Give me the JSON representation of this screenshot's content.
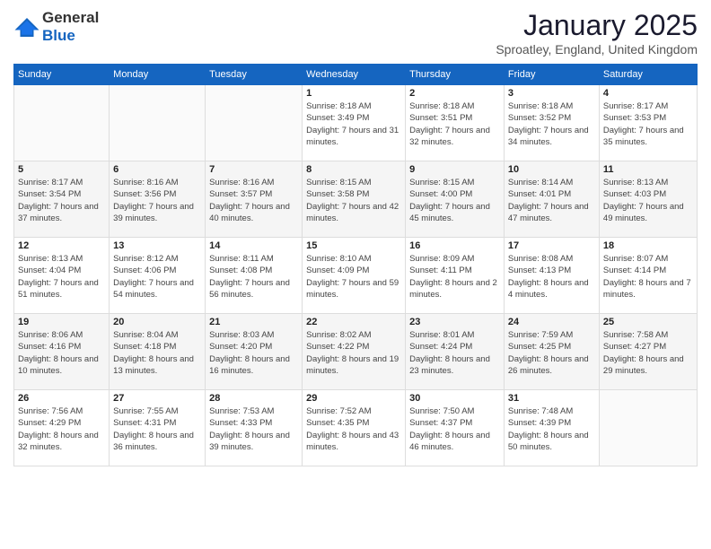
{
  "header": {
    "logo_general": "General",
    "logo_blue": "Blue",
    "title": "January 2025",
    "location": "Sproatley, England, United Kingdom"
  },
  "days_of_week": [
    "Sunday",
    "Monday",
    "Tuesday",
    "Wednesday",
    "Thursday",
    "Friday",
    "Saturday"
  ],
  "weeks": [
    [
      {
        "day": "",
        "sunrise": "",
        "sunset": "",
        "daylight": ""
      },
      {
        "day": "",
        "sunrise": "",
        "sunset": "",
        "daylight": ""
      },
      {
        "day": "",
        "sunrise": "",
        "sunset": "",
        "daylight": ""
      },
      {
        "day": "1",
        "sunrise": "Sunrise: 8:18 AM",
        "sunset": "Sunset: 3:49 PM",
        "daylight": "Daylight: 7 hours and 31 minutes."
      },
      {
        "day": "2",
        "sunrise": "Sunrise: 8:18 AM",
        "sunset": "Sunset: 3:51 PM",
        "daylight": "Daylight: 7 hours and 32 minutes."
      },
      {
        "day": "3",
        "sunrise": "Sunrise: 8:18 AM",
        "sunset": "Sunset: 3:52 PM",
        "daylight": "Daylight: 7 hours and 34 minutes."
      },
      {
        "day": "4",
        "sunrise": "Sunrise: 8:17 AM",
        "sunset": "Sunset: 3:53 PM",
        "daylight": "Daylight: 7 hours and 35 minutes."
      }
    ],
    [
      {
        "day": "5",
        "sunrise": "Sunrise: 8:17 AM",
        "sunset": "Sunset: 3:54 PM",
        "daylight": "Daylight: 7 hours and 37 minutes."
      },
      {
        "day": "6",
        "sunrise": "Sunrise: 8:16 AM",
        "sunset": "Sunset: 3:56 PM",
        "daylight": "Daylight: 7 hours and 39 minutes."
      },
      {
        "day": "7",
        "sunrise": "Sunrise: 8:16 AM",
        "sunset": "Sunset: 3:57 PM",
        "daylight": "Daylight: 7 hours and 40 minutes."
      },
      {
        "day": "8",
        "sunrise": "Sunrise: 8:15 AM",
        "sunset": "Sunset: 3:58 PM",
        "daylight": "Daylight: 7 hours and 42 minutes."
      },
      {
        "day": "9",
        "sunrise": "Sunrise: 8:15 AM",
        "sunset": "Sunset: 4:00 PM",
        "daylight": "Daylight: 7 hours and 45 minutes."
      },
      {
        "day": "10",
        "sunrise": "Sunrise: 8:14 AM",
        "sunset": "Sunset: 4:01 PM",
        "daylight": "Daylight: 7 hours and 47 minutes."
      },
      {
        "day": "11",
        "sunrise": "Sunrise: 8:13 AM",
        "sunset": "Sunset: 4:03 PM",
        "daylight": "Daylight: 7 hours and 49 minutes."
      }
    ],
    [
      {
        "day": "12",
        "sunrise": "Sunrise: 8:13 AM",
        "sunset": "Sunset: 4:04 PM",
        "daylight": "Daylight: 7 hours and 51 minutes."
      },
      {
        "day": "13",
        "sunrise": "Sunrise: 8:12 AM",
        "sunset": "Sunset: 4:06 PM",
        "daylight": "Daylight: 7 hours and 54 minutes."
      },
      {
        "day": "14",
        "sunrise": "Sunrise: 8:11 AM",
        "sunset": "Sunset: 4:08 PM",
        "daylight": "Daylight: 7 hours and 56 minutes."
      },
      {
        "day": "15",
        "sunrise": "Sunrise: 8:10 AM",
        "sunset": "Sunset: 4:09 PM",
        "daylight": "Daylight: 7 hours and 59 minutes."
      },
      {
        "day": "16",
        "sunrise": "Sunrise: 8:09 AM",
        "sunset": "Sunset: 4:11 PM",
        "daylight": "Daylight: 8 hours and 2 minutes."
      },
      {
        "day": "17",
        "sunrise": "Sunrise: 8:08 AM",
        "sunset": "Sunset: 4:13 PM",
        "daylight": "Daylight: 8 hours and 4 minutes."
      },
      {
        "day": "18",
        "sunrise": "Sunrise: 8:07 AM",
        "sunset": "Sunset: 4:14 PM",
        "daylight": "Daylight: 8 hours and 7 minutes."
      }
    ],
    [
      {
        "day": "19",
        "sunrise": "Sunrise: 8:06 AM",
        "sunset": "Sunset: 4:16 PM",
        "daylight": "Daylight: 8 hours and 10 minutes."
      },
      {
        "day": "20",
        "sunrise": "Sunrise: 8:04 AM",
        "sunset": "Sunset: 4:18 PM",
        "daylight": "Daylight: 8 hours and 13 minutes."
      },
      {
        "day": "21",
        "sunrise": "Sunrise: 8:03 AM",
        "sunset": "Sunset: 4:20 PM",
        "daylight": "Daylight: 8 hours and 16 minutes."
      },
      {
        "day": "22",
        "sunrise": "Sunrise: 8:02 AM",
        "sunset": "Sunset: 4:22 PM",
        "daylight": "Daylight: 8 hours and 19 minutes."
      },
      {
        "day": "23",
        "sunrise": "Sunrise: 8:01 AM",
        "sunset": "Sunset: 4:24 PM",
        "daylight": "Daylight: 8 hours and 23 minutes."
      },
      {
        "day": "24",
        "sunrise": "Sunrise: 7:59 AM",
        "sunset": "Sunset: 4:25 PM",
        "daylight": "Daylight: 8 hours and 26 minutes."
      },
      {
        "day": "25",
        "sunrise": "Sunrise: 7:58 AM",
        "sunset": "Sunset: 4:27 PM",
        "daylight": "Daylight: 8 hours and 29 minutes."
      }
    ],
    [
      {
        "day": "26",
        "sunrise": "Sunrise: 7:56 AM",
        "sunset": "Sunset: 4:29 PM",
        "daylight": "Daylight: 8 hours and 32 minutes."
      },
      {
        "day": "27",
        "sunrise": "Sunrise: 7:55 AM",
        "sunset": "Sunset: 4:31 PM",
        "daylight": "Daylight: 8 hours and 36 minutes."
      },
      {
        "day": "28",
        "sunrise": "Sunrise: 7:53 AM",
        "sunset": "Sunset: 4:33 PM",
        "daylight": "Daylight: 8 hours and 39 minutes."
      },
      {
        "day": "29",
        "sunrise": "Sunrise: 7:52 AM",
        "sunset": "Sunset: 4:35 PM",
        "daylight": "Daylight: 8 hours and 43 minutes."
      },
      {
        "day": "30",
        "sunrise": "Sunrise: 7:50 AM",
        "sunset": "Sunset: 4:37 PM",
        "daylight": "Daylight: 8 hours and 46 minutes."
      },
      {
        "day": "31",
        "sunrise": "Sunrise: 7:48 AM",
        "sunset": "Sunset: 4:39 PM",
        "daylight": "Daylight: 8 hours and 50 minutes."
      },
      {
        "day": "",
        "sunrise": "",
        "sunset": "",
        "daylight": ""
      }
    ]
  ]
}
